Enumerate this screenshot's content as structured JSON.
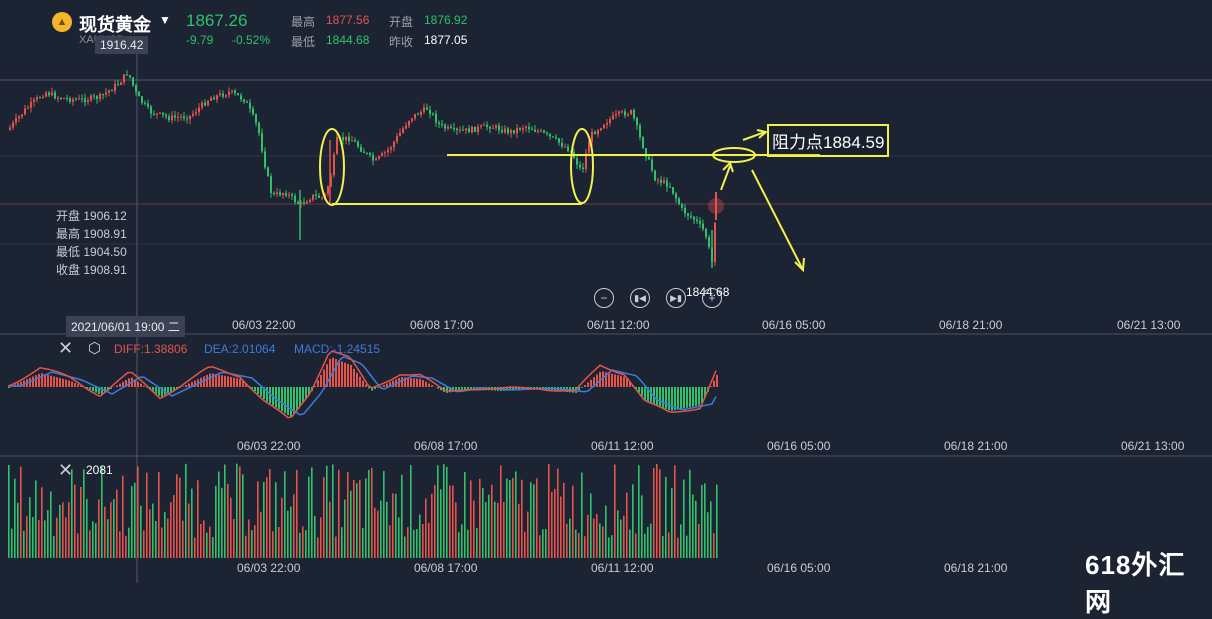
{
  "header": {
    "instrument_name": "现货黄金",
    "symbol": "XAUUSD",
    "last_price": "1867.26",
    "change": "-9.79",
    "change_pct": "-0.52%",
    "high_label": "最高",
    "high_value": "1877.56",
    "open_label": "开盘",
    "open_value": "1876.92",
    "low_label": "最低",
    "low_value": "1844.68",
    "prev_close_label": "昨收",
    "prev_close_value": "1877.05"
  },
  "crosshair": {
    "price_tag": "1916.42",
    "time_tag": "2021/06/01 19:00 二",
    "ohlc": [
      {
        "label": "开盘",
        "value": "1906.12"
      },
      {
        "label": "最高",
        "value": "1908.91"
      },
      {
        "label": "最低",
        "value": "1904.50"
      },
      {
        "label": "收盘",
        "value": "1908.91"
      }
    ]
  },
  "low_marker": "1844.68",
  "annotation": {
    "resistance_label": "阻力点1884.59"
  },
  "x_axis_labels": [
    "06/03 22:00",
    "06/08 17:00",
    "06/11 12:00",
    "06/16 05:00",
    "06/18 21:00",
    "06/21 13:00"
  ],
  "macd": {
    "diff_label": "DIFF:1.38806",
    "dea_label": "DEA:2.01064",
    "macd_label": "MACD:-1.24515"
  },
  "volume": {
    "value_label": "2081"
  },
  "controls": [
    "zoom-out",
    "previous",
    "next",
    "zoom-in"
  ],
  "watermark": "618外汇网",
  "colors": {
    "background": "#1c2333",
    "up": "#e5534b",
    "down": "#2fc26a",
    "annotation": "#f2f24d",
    "dea_line": "#3b7ddd",
    "diff_line": "#e5534b"
  }
}
